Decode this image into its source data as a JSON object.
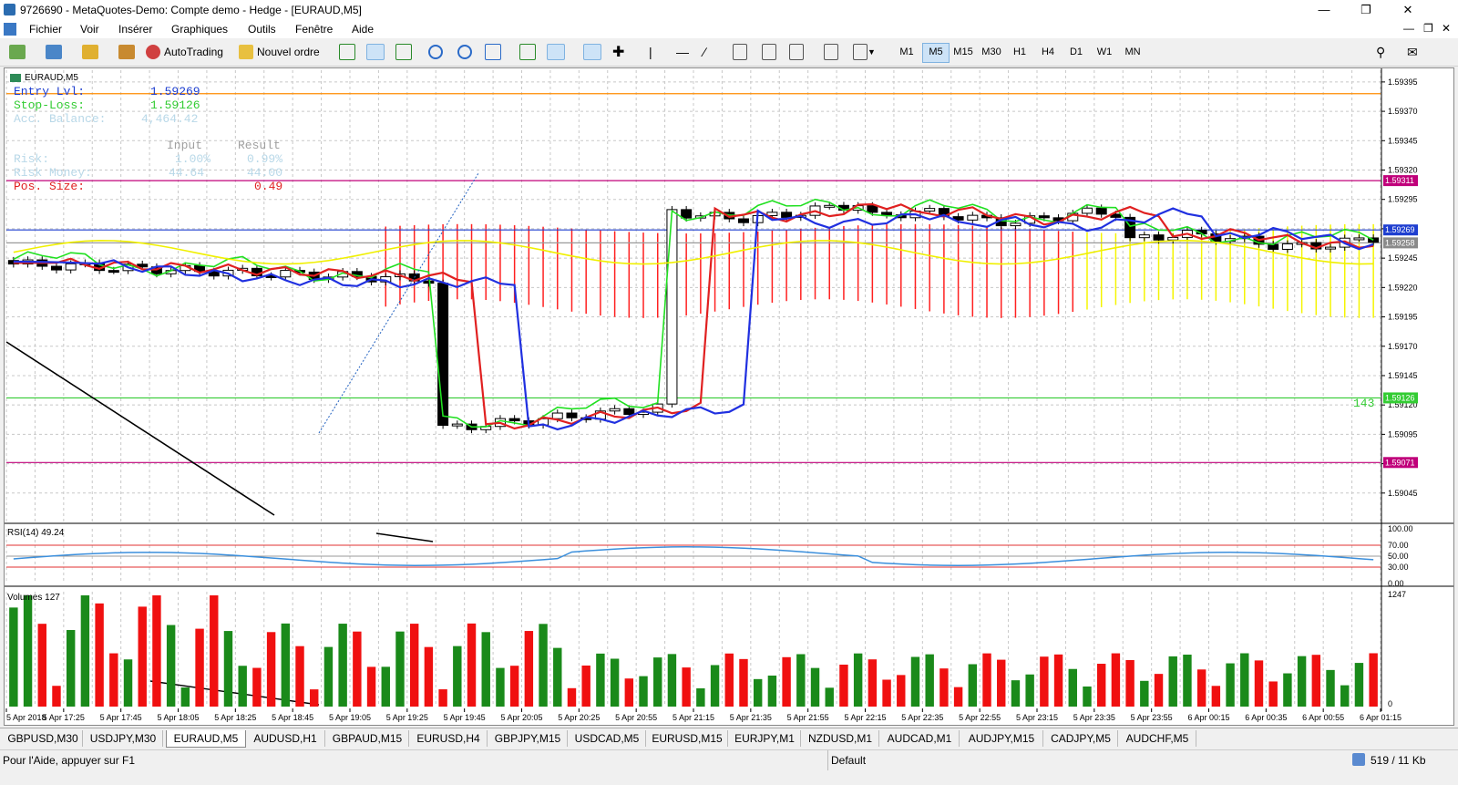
{
  "window": {
    "title": "9726690 - MetaQuotes-Demo: Compte demo - Hedge - [EURAUD,M5]"
  },
  "menu": [
    "Fichier",
    "Voir",
    "Insérer",
    "Graphiques",
    "Outils",
    "Fenêtre",
    "Aide"
  ],
  "toolbar": {
    "autotrading_label": "AutoTrading",
    "new_order_label": "Nouvel ordre"
  },
  "timeframes": {
    "items": [
      "M1",
      "M5",
      "M15",
      "M30",
      "H1",
      "H4",
      "D1",
      "W1",
      "MN"
    ],
    "active": "M5"
  },
  "chart": {
    "symbol_label": "EURAUD,M5",
    "panel": {
      "entry_label": "Entry Lvl:",
      "entry_value": "1.59269",
      "stop_label": "Stop-Loss:",
      "stop_value": "1.59126",
      "balance_label": "Acc. Balance:",
      "balance_value": "4,464.42",
      "col_input": "Input",
      "col_result": "Result",
      "risk_label": "Risk:",
      "risk_input": "1.00%",
      "risk_result": "0.99%",
      "money_label": "Risk Money:",
      "money_input": "44.64",
      "money_result": "44.00",
      "size_label": "Pos. Size:",
      "size_value": "0.49"
    },
    "price_axis": [
      "1.59395",
      "1.59370",
      "1.59345",
      "1.59320",
      "1.59295",
      "1.59270",
      "1.59245",
      "1.59220",
      "1.59195",
      "1.59170",
      "1.59145",
      "1.59120",
      "1.59095",
      "1.59070",
      "1.59045"
    ],
    "price_tags": [
      {
        "value": "1.59311",
        "color": "#c0007a"
      },
      {
        "value": "1.59269",
        "color": "#1f3fd0"
      },
      {
        "value": "1.59258",
        "color": "#8a8a8a"
      },
      {
        "value": "1.59126",
        "color": "#33cc33"
      },
      {
        "value": "1.59071",
        "color": "#c0007a"
      }
    ],
    "stop_points_label": "143",
    "time_axis": [
      "5 Apr 2018",
      "5 Apr 17:25",
      "5 Apr 17:45",
      "5 Apr 18:05",
      "5 Apr 18:25",
      "5 Apr 18:45",
      "5 Apr 19:05",
      "5 Apr 19:25",
      "5 Apr 19:45",
      "5 Apr 20:05",
      "5 Apr 20:25",
      "5 Apr 20:55",
      "5 Apr 21:15",
      "5 Apr 21:35",
      "5 Apr 21:55",
      "5 Apr 22:15",
      "5 Apr 22:35",
      "5 Apr 22:55",
      "5 Apr 23:15",
      "5 Apr 23:35",
      "5 Apr 23:55",
      "6 Apr 00:15",
      "6 Apr 00:35",
      "6 Apr 00:55",
      "6 Apr 01:15"
    ]
  },
  "rsi": {
    "label": "RSI(14) 49.24",
    "axis": [
      "100.00",
      "70.00",
      "50.00",
      "30.00",
      "0.00"
    ]
  },
  "volumes": {
    "label": "Volumes 127",
    "axis_top": "1247",
    "axis_bottom": "0"
  },
  "tabs": {
    "items": [
      "GBPUSD,M30",
      "USDJPY,M30",
      "EURAUD,M5",
      "AUDUSD,H1",
      "GBPAUD,M15",
      "EURUSD,H4",
      "GBPJPY,M15",
      "USDCAD,M5",
      "EURUSD,M15",
      "EURJPY,M1",
      "NZDUSD,M1",
      "AUDCAD,M1",
      "AUDJPY,M15",
      "CADJPY,M5",
      "AUDCHF,M5"
    ],
    "active": "EURAUD,M5"
  },
  "status": {
    "help": "Pour l'Aide, appuyer sur F1",
    "profile": "Default",
    "traffic": "519 / 11 Kb"
  }
}
